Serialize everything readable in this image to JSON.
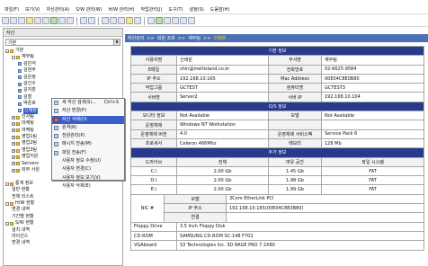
{
  "menubar": [
    "파일(F)",
    "보기(V)",
    "자산관리(A)",
    "S/W 관리(W)",
    "H/W 관리(H)",
    "작업관리(J)",
    "도구(T)",
    "설정(S)",
    "도움말(H)"
  ],
  "left_pane": {
    "title": "자산",
    "combo_value": "기본",
    "tree": [
      {
        "label": "기본",
        "pm": "-",
        "icon": "folder",
        "indent": 0
      },
      {
        "label": "재무팀",
        "pm": "-",
        "icon": "folder",
        "indent": 1
      },
      {
        "label": "김민석",
        "pm": "",
        "icon": "pc",
        "indent": 2
      },
      {
        "label": "김현주",
        "pm": "",
        "icon": "pc",
        "indent": 2
      },
      {
        "label": "김은정",
        "pm": "",
        "icon": "pc",
        "indent": 2
      },
      {
        "label": "김인수",
        "pm": "",
        "icon": "pc",
        "indent": 2
      },
      {
        "label": "김지훈",
        "pm": "",
        "icon": "pc",
        "indent": 2
      },
      {
        "label": "김철",
        "pm": "",
        "icon": "pc",
        "indent": 2
      },
      {
        "label": "박준호",
        "pm": "",
        "icon": "pc",
        "indent": 2
      },
      {
        "label": "신태원",
        "pm": "",
        "icon": "pc",
        "indent": 2,
        "selected": true
      },
      {
        "label": "인사팀",
        "pm": "+",
        "icon": "folder",
        "indent": 1
      },
      {
        "label": "마케팅",
        "pm": "+",
        "icon": "folder",
        "indent": 1
      },
      {
        "label": "마케팅",
        "pm": "+",
        "icon": "folder",
        "indent": 1
      },
      {
        "label": "영업1팀",
        "pm": "+",
        "icon": "folder",
        "indent": 1
      },
      {
        "label": "영업2팀",
        "pm": "+",
        "icon": "folder",
        "indent": 1
      },
      {
        "label": "영업3팀",
        "pm": "+",
        "icon": "folder",
        "indent": 1
      },
      {
        "label": "영업지원",
        "pm": "+",
        "icon": "folder",
        "indent": 1
      },
      {
        "label": "Servers",
        "pm": "+",
        "icon": "folder",
        "indent": 1
      },
      {
        "label": "외부 사원",
        "pm": "+",
        "icon": "folder",
        "indent": 1
      },
      {
        "label": "",
        "pm": "",
        "icon": "",
        "indent": 0
      },
      {
        "label": "통계 정보",
        "pm": "-",
        "icon": "folder",
        "indent": 0
      },
      {
        "label": "일반 현황",
        "pm": "",
        "icon": "",
        "indent": 1
      },
      {
        "label": "전체 리스트",
        "pm": "",
        "icon": "",
        "indent": 1
      },
      {
        "label": "H/W 현황",
        "pm": "-",
        "icon": "folder",
        "indent": 0
      },
      {
        "label": "변경 내역",
        "pm": "",
        "icon": "",
        "indent": 1
      },
      {
        "label": "기간별 현황",
        "pm": "",
        "icon": "",
        "indent": 1
      },
      {
        "label": "S/W 현황",
        "pm": "-",
        "icon": "folder",
        "indent": 0
      },
      {
        "label": "설치 내역",
        "pm": "",
        "icon": "",
        "indent": 1
      },
      {
        "label": "라이선스",
        "pm": "",
        "icon": "",
        "indent": 1
      },
      {
        "label": "변경 내역",
        "pm": "",
        "icon": "",
        "indent": 1
      }
    ]
  },
  "context_menu": [
    {
      "label": "새 자산 검색(S)...",
      "shortcut": "Ctrl+S",
      "icon": "new-icon"
    },
    {
      "label": "자산 변경(P)",
      "shortcut": "",
      "icon": "edit-icon"
    },
    {
      "label": "자산 삭제(D)",
      "shortcut": "",
      "icon": "delete-icon",
      "highlight": true
    },
    {
      "label": "원격(R)",
      "shortcut": "",
      "icon": "remote-icon"
    },
    {
      "label": "전원관리(P)",
      "shortcut": "",
      "icon": "power-icon"
    },
    {
      "label": "메시지 전송(M)",
      "shortcut": "",
      "icon": "message-icon"
    },
    {
      "label": "파일 전송(F)",
      "shortcut": "",
      "icon": "file-icon"
    },
    {
      "label": "사용자 정보 수정(U)",
      "shortcut": "",
      "icon": ""
    },
    {
      "label": "사용자 변경(C)",
      "shortcut": "",
      "icon": ""
    },
    {
      "label": "사용자 정보 보기(V)",
      "shortcut": "",
      "icon": ""
    },
    {
      "label": "사용자 삭제(E)",
      "shortcut": "",
      "icon": ""
    }
  ],
  "address_bar": {
    "segments": [
      "자산관리",
      ">>",
      "회원 조회",
      ">>",
      "재무팀",
      ">>"
    ],
    "highlight": "신태원"
  },
  "sections": {
    "basic": "기본 정보",
    "os": "O/S 정보",
    "hw": "추가 정보"
  },
  "basic_info": [
    {
      "l1": "사용자명",
      "v1": "신태원",
      "l2": "부서명",
      "v2": "재무팀"
    },
    {
      "l1": "E메일",
      "v1": "shin@meitisland.co.kr",
      "l2": "전화번호",
      "v2": "02-6625-9584"
    },
    {
      "l1": "IP 주소",
      "v1": "192.168.10.165",
      "l2": "Mac Address",
      "v2": "00E04C8E0B80"
    },
    {
      "l1": "작업그룹",
      "v1": "GCTEST",
      "l2": "컴퓨터명",
      "v2": "GCTEST3"
    },
    {
      "l1": "서버명",
      "v1": "Server2",
      "l2": "서버 IP",
      "v2": "192.168.10.104"
    }
  ],
  "os_info": [
    {
      "l1": "모니터 정보",
      "v1": "Not Available",
      "l2": "모델",
      "v2": "Not Available"
    },
    {
      "l1": "운영체제",
      "v1": "Windows NT Workstation",
      "l2": "",
      "v2": ""
    },
    {
      "l1": "운영체제 버전",
      "v1": "4.0",
      "l2": "운영체제 서비스팩",
      "v2": "Service Pack 6"
    },
    {
      "l1": "프로세서",
      "v1": "Celeron 466Mhz",
      "l2": "메모리",
      "v2": "128 Mb"
    }
  ],
  "hw_headers": [
    "드라이브",
    "전체",
    "여유 공간",
    "파일 시스템"
  ],
  "drives": [
    {
      "name": "C:\\",
      "total": "2.00 Gb",
      "free": "1.45 Gb",
      "fs": "FAT"
    },
    {
      "name": "D:\\",
      "total": "2.00 Gb",
      "free": "1.98 Gb",
      "fs": "FAT"
    },
    {
      "name": "E:\\",
      "total": "2.00 Gb",
      "free": "1.99 Gb",
      "fs": "FAT"
    }
  ],
  "nic": {
    "label": "NIC #",
    "rows": [
      {
        "k": "모델",
        "v": "3Com EtherLink PCI"
      },
      {
        "k": "IP 주소",
        "v": "192.168.10.165(00E04C8E0B80)"
      },
      {
        "k": "연결",
        "v": ""
      }
    ]
  },
  "devices": [
    {
      "k": "Floppy Drive",
      "v": "3.5 Inch Floppy Disk"
    },
    {
      "k": "CD-ROM",
      "v": "SAMSUNG CD-ROM SC-148 F702"
    },
    {
      "k": "VGAboard",
      "v": "S3 Technologies Inc. 3D RAGE PRO 7 2X80"
    }
  ]
}
